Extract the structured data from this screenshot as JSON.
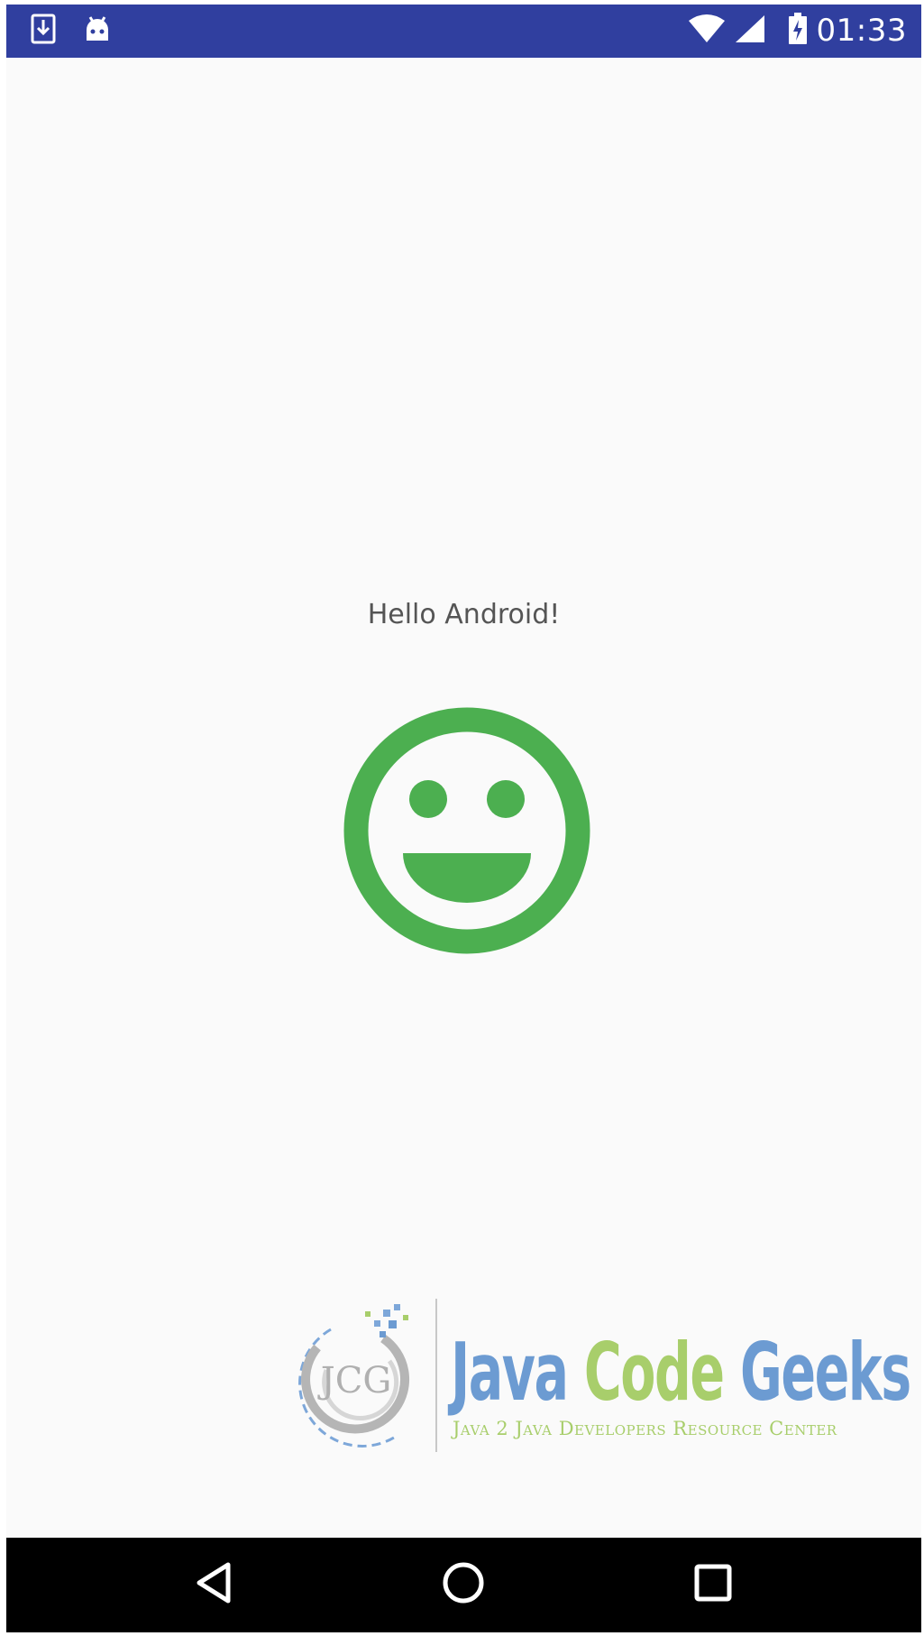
{
  "status_bar": {
    "time": "01:33",
    "left_icons": [
      "download-notification-icon",
      "android-debug-icon"
    ],
    "right_icons": [
      "wifi-icon",
      "cell-signal-icon",
      "battery-charging-icon"
    ],
    "background_color": "#303f9f"
  },
  "main": {
    "greeting_text": "Hello Android!",
    "image_icon": "smiley-face-icon",
    "image_color": "#4caf50"
  },
  "watermark": {
    "emblem_text": "JCG",
    "title_part1": "Java",
    "title_part2": "Code",
    "title_part3": "Geeks",
    "subtitle": "Java 2 Java Developers Resource Center"
  },
  "nav_bar": {
    "buttons": [
      "back-icon",
      "home-icon",
      "recents-icon"
    ]
  }
}
